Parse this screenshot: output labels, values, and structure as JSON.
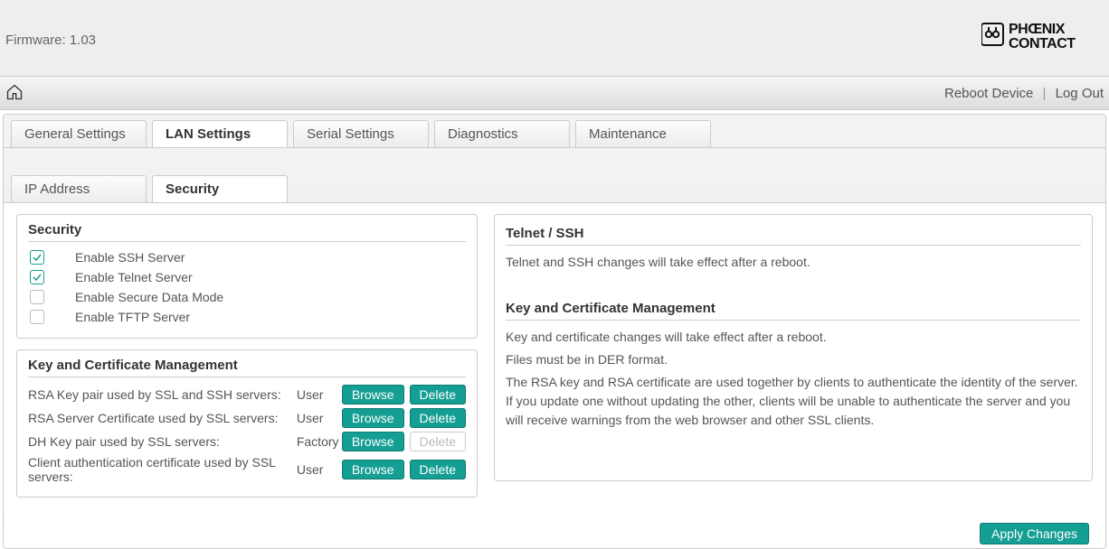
{
  "header": {
    "firmware_label": "Firmware: 1.03",
    "brand_top": "PHŒNIX",
    "brand_bottom": "CONTACT"
  },
  "navbar": {
    "reboot": "Reboot Device",
    "logout": "Log Out"
  },
  "tabs": {
    "general": "General Settings",
    "lan": "LAN Settings",
    "serial": "Serial Settings",
    "diagnostics": "Diagnostics",
    "maintenance": "Maintenance"
  },
  "subtabs": {
    "ip": "IP Address",
    "security": "Security"
  },
  "security_panel": {
    "title": "Security",
    "items": [
      {
        "label": "Enable SSH Server",
        "checked": true
      },
      {
        "label": "Enable Telnet Server",
        "checked": true
      },
      {
        "label": "Enable Secure Data Mode",
        "checked": false
      },
      {
        "label": "Enable TFTP Server",
        "checked": false
      }
    ]
  },
  "keycert_panel": {
    "title": "Key and Certificate Management",
    "rows": [
      {
        "label": "RSA Key pair used by SSL and SSH servers:",
        "value": "User",
        "browse": "Browse",
        "delete": "Delete",
        "delete_enabled": true
      },
      {
        "label": "RSA Server Certificate used by SSL servers:",
        "value": "User",
        "browse": "Browse",
        "delete": "Delete",
        "delete_enabled": true
      },
      {
        "label": "DH Key pair used by SSL servers:",
        "value": "Factory",
        "browse": "Browse",
        "delete": "Delete",
        "delete_enabled": false
      },
      {
        "label": "Client authentication certificate used by SSL servers:",
        "value": "User",
        "browse": "Browse",
        "delete": "Delete",
        "delete_enabled": true
      }
    ]
  },
  "info_panel": {
    "telnet_title": "Telnet / SSH",
    "telnet_body": "Telnet and SSH changes will take effect after a reboot.",
    "kc_title": "Key and Certificate Management",
    "kc_body1": "Key and certificate changes will take effect after a reboot.",
    "kc_body2": "Files must be in DER format.",
    "kc_body3": "The RSA key and RSA certificate are used together by clients to authenticate the identity of the server. If you update one without updating the other, clients will be unable to authenticate the server and you will receive warnings from the web browser and other SSL clients."
  },
  "footer": {
    "apply": "Apply Changes"
  }
}
